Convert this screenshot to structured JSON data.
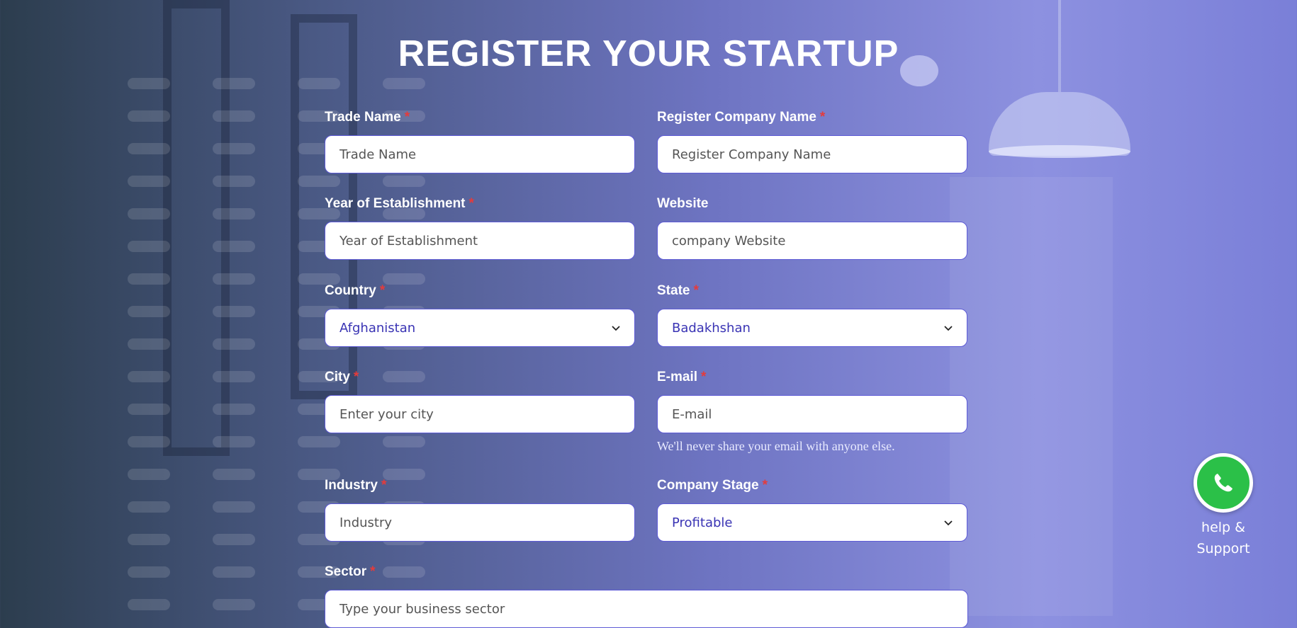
{
  "page": {
    "title": "REGISTER YOUR STARTUP"
  },
  "form": {
    "trade_name": {
      "label": "Trade Name",
      "placeholder": "Trade Name",
      "required": true
    },
    "register_company_name": {
      "label": "Register Company Name",
      "placeholder": "Register Company Name",
      "required": true
    },
    "year_of_establishment": {
      "label": "Year of Establishment",
      "placeholder": "Year of Establishment",
      "required": true
    },
    "website": {
      "label": "Website",
      "placeholder": "company Website",
      "required": false
    },
    "country": {
      "label": "Country",
      "value": "Afghanistan",
      "required": true
    },
    "state": {
      "label": "State",
      "value": "Badakhshan",
      "required": true
    },
    "city": {
      "label": "City",
      "placeholder": "Enter your city",
      "required": true
    },
    "email": {
      "label": "E-mail",
      "placeholder": "E-mail",
      "help": "We'll never share your email with anyone else.",
      "required": true
    },
    "industry": {
      "label": "Industry",
      "placeholder": "Industry",
      "required": true
    },
    "company_stage": {
      "label": "Company Stage",
      "value": "Profitable",
      "required": true
    },
    "sector": {
      "label": "Sector",
      "placeholder": "Type your business sector",
      "required": true
    },
    "required_marker": "*"
  },
  "support": {
    "line1": "help &",
    "line2": "Support",
    "icon": "whatsapp-icon"
  },
  "colors": {
    "accent": "#5e5bd6",
    "select_text": "#3a34b4",
    "required": "#e53b3b",
    "whatsapp": "#2bc048"
  }
}
